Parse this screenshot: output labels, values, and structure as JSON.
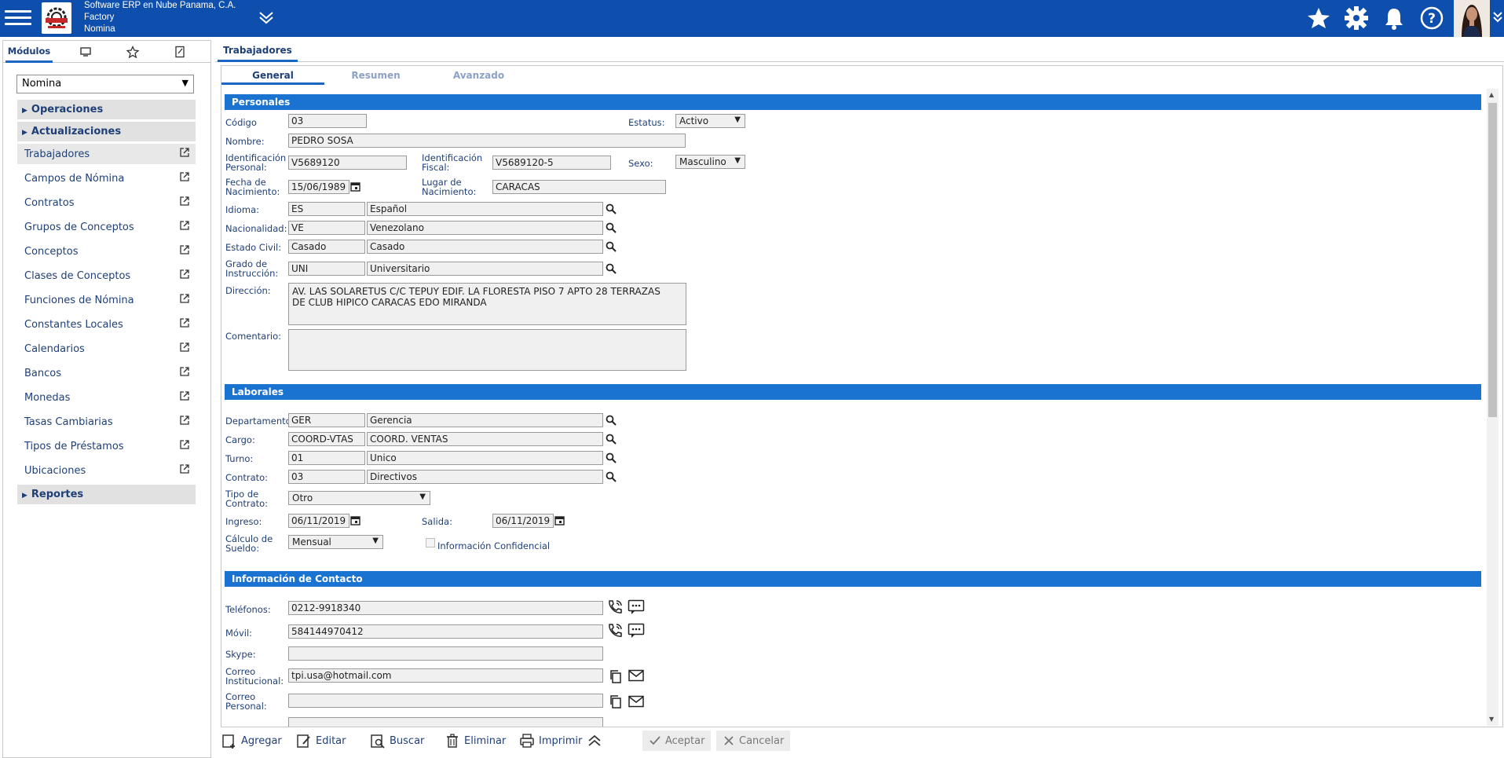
{
  "header": {
    "company": "Software ERP en Nube Panama, C.A.",
    "branch": "Factory",
    "module": "Nomina"
  },
  "left_panel": {
    "tab_modulos": "Módulos",
    "module_select": "Nomina",
    "sections": {
      "operaciones": "Operaciones",
      "actualizaciones": "Actualizaciones",
      "reportes": "Reportes"
    },
    "items": [
      {
        "label": "Trabajadores"
      },
      {
        "label": "Campos de Nómina"
      },
      {
        "label": "Contratos"
      },
      {
        "label": "Grupos de Conceptos"
      },
      {
        "label": "Conceptos"
      },
      {
        "label": "Clases de Conceptos"
      },
      {
        "label": "Funciones de Nómina"
      },
      {
        "label": "Constantes Locales"
      },
      {
        "label": "Calendarios"
      },
      {
        "label": "Bancos"
      },
      {
        "label": "Monedas"
      },
      {
        "label": "Tasas Cambiarias"
      },
      {
        "label": "Tipos de Préstamos"
      },
      {
        "label": "Ubicaciones"
      }
    ]
  },
  "main": {
    "tab": "Trabajadores",
    "subtabs": [
      "General",
      "Resumen",
      "Avanzado"
    ]
  },
  "personales": {
    "title": "Personales",
    "codigo_label": "Código",
    "codigo": "03",
    "estatus_label": "Estatus:",
    "estatus": "Activo",
    "nombre_label": "Nombre:",
    "nombre": "PEDRO SOSA",
    "id_personal_label_1": "Identificación",
    "id_personal_label_2": "Personal:",
    "id_personal": "V5689120",
    "id_fiscal_label_1": "Identificación",
    "id_fiscal_label_2": "Fiscal:",
    "id_fiscal": "V5689120-5",
    "sexo_label": "Sexo:",
    "sexo": "Masculino",
    "fecha_nac_label_1": "Fecha de",
    "fecha_nac_label_2": "Nacimiento:",
    "fecha_nac": "15/06/1989",
    "lugar_nac_label_1": "Lugar de",
    "lugar_nac_label_2": "Nacimiento:",
    "lugar_nac": "CARACAS",
    "idioma_label": "Idioma:",
    "idioma_code": "ES",
    "idioma_desc": "Español",
    "nacionalidad_label": "Nacionalidad:",
    "nacionalidad_code": "VE",
    "nacionalidad_desc": "Venezolano",
    "estado_civil_label": "Estado Civil:",
    "estado_civil_code": "Casado",
    "estado_civil_desc": "Casado",
    "grado_label_1": "Grado de",
    "grado_label_2": "Instrucción:",
    "grado_code": "UNI",
    "grado_desc": "Universitario",
    "direccion_label": "Dirección:",
    "direccion_1": "AV. LAS SOLARETUS C/C TEPUY EDIF. LA FLORESTA PISO 7 APTO 28 TERRAZAS",
    "direccion_2": "DE CLUB HIPICO  CARACAS EDO MIRANDA",
    "comentario_label": "Comentario:",
    "comentario": ""
  },
  "laborales": {
    "title": "Laborales",
    "departamento_label": "Departamento",
    "departamento_code": "GER",
    "departamento_desc": "Gerencia",
    "cargo_label": "Cargo:",
    "cargo_code": "COORD-VTAS",
    "cargo_desc": "COORD. VENTAS",
    "turno_label": "Turno:",
    "turno_code": "01",
    "turno_desc": "Unico",
    "contrato_label": "Contrato:",
    "contrato_code": "03",
    "contrato_desc": "Directivos",
    "tipo_contrato_label_1": "Tipo de",
    "tipo_contrato_label_2": "Contrato:",
    "tipo_contrato": "Otro",
    "ingreso_label": "Ingreso:",
    "ingreso": "06/11/2019",
    "salida_label": "Salida:",
    "salida": "06/11/2019",
    "calculo_label_1": "Cálculo de",
    "calculo_label_2": "Sueldo:",
    "calculo": "Mensual",
    "confidencial_label": "Información Confidencial",
    "confidencial_checked": false
  },
  "contacto": {
    "title": "Información de Contacto",
    "telefonos_label": "Teléfonos:",
    "telefonos": "0212-9918340",
    "movil_label": "Móvil:",
    "movil": "584144970412",
    "skype_label": "Skype:",
    "skype": "",
    "correo_inst_label_1": "Correo",
    "correo_inst_label_2": "Institucional:",
    "correo_inst": "tpi.usa@hotmail.com",
    "correo_pers_label_1": "Correo",
    "correo_pers_label_2": "Personal:",
    "correo_pers": ""
  },
  "toolbar": {
    "agregar": "Agregar",
    "editar": "Editar",
    "buscar": "Buscar",
    "eliminar": "Eliminar",
    "imprimir": "Imprimir",
    "aceptar": "Aceptar",
    "cancelar": "Cancelar"
  },
  "colors": {
    "header_bg": "#0e4fae",
    "section_bar": "#1a73d0",
    "text": "#1f3f77"
  }
}
